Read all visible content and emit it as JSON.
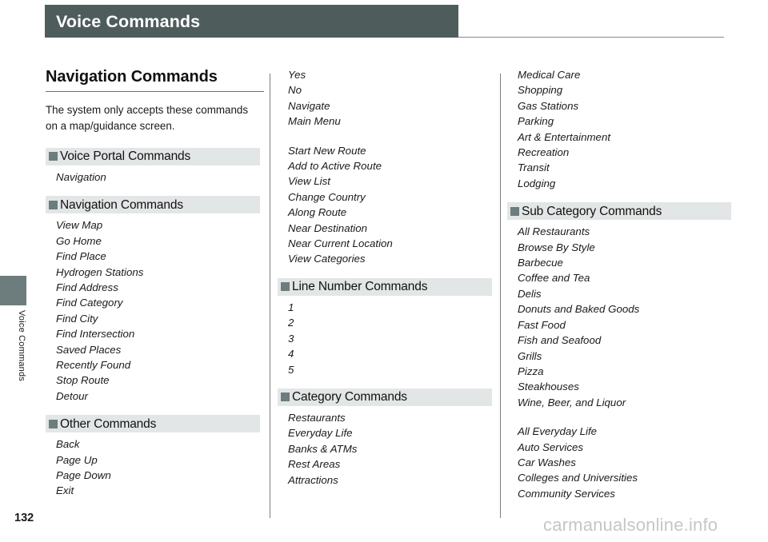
{
  "header": {
    "title": "Voice Commands"
  },
  "sidebar": {
    "tab_label": "Voice Commands",
    "page_number": "132"
  },
  "watermark": "carmanualsonline.info",
  "left_column": {
    "section_title": "Navigation Commands",
    "intro": "The system only accepts these commands on a map/guidance screen.",
    "sections": [
      {
        "heading": "Voice Portal Commands",
        "groups": [
          [
            "Navigation"
          ]
        ]
      },
      {
        "heading": "Navigation Commands",
        "groups": [
          [
            "View Map",
            "Go Home",
            "Find Place",
            "Hydrogen Stations",
            "Find Address",
            "Find Category",
            "Find City",
            "Find Intersection",
            "Saved Places",
            "Recently Found",
            "Stop Route",
            "Detour"
          ]
        ]
      },
      {
        "heading": "Other Commands",
        "groups": [
          [
            "Back",
            "Page Up",
            "Page Down",
            "Exit"
          ]
        ]
      }
    ]
  },
  "middle_column": {
    "continuation": {
      "groups": [
        [
          "Yes",
          "No",
          "Navigate",
          "Main Menu"
        ],
        [
          "Start New Route",
          "Add to Active Route",
          "View List",
          "Change Country",
          "Along Route",
          "Near Destination",
          "Near Current Location",
          "View Categories"
        ]
      ]
    },
    "sections": [
      {
        "heading": "Line Number Commands",
        "groups": [
          [
            "1",
            "2",
            "3",
            "4",
            "5"
          ]
        ]
      },
      {
        "heading": "Category Commands",
        "groups": [
          [
            "Restaurants",
            "Everyday Life",
            "Banks & ATMs",
            "Rest Areas",
            "Attractions"
          ]
        ]
      }
    ]
  },
  "right_column": {
    "continuation": {
      "groups": [
        [
          "Medical Care",
          "Shopping",
          "Gas Stations",
          "Parking",
          "Art & Entertainment",
          "Recreation",
          "Transit",
          "Lodging"
        ]
      ]
    },
    "sections": [
      {
        "heading": "Sub Category Commands",
        "groups": [
          [
            "All Restaurants",
            "Browse By Style",
            "Barbecue",
            "Coffee and Tea",
            "Delis",
            "Donuts and Baked Goods",
            "Fast Food",
            "Fish and Seafood",
            "Grills",
            "Pizza",
            "Steakhouses",
            "Wine, Beer, and Liquor"
          ],
          [
            "All Everyday Life",
            "Auto Services",
            "Car Washes",
            "Colleges and Universities",
            "Community Services"
          ]
        ]
      }
    ]
  },
  "colors": {
    "header_banner": "#4e5c5c",
    "section_band": "#e3e6e6",
    "bullet": "#6d7c7c",
    "text": "#1a1a1a",
    "watermark": "#c6c6c6"
  }
}
